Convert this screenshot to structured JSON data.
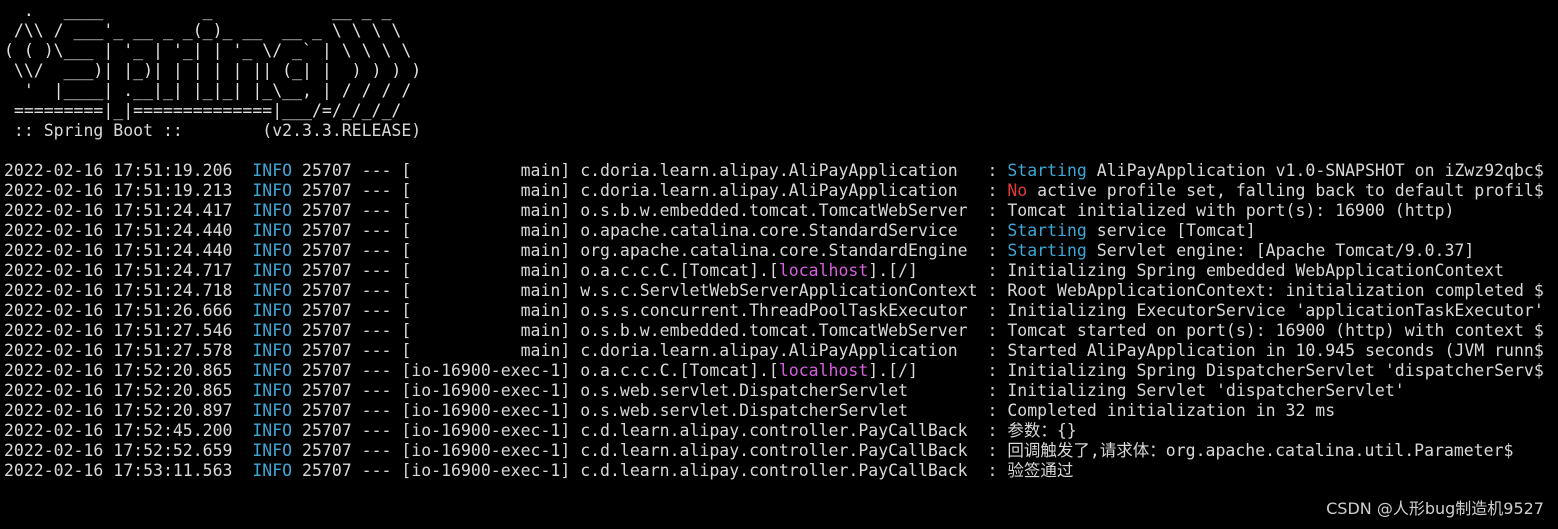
{
  "banner": {
    "ascii_lines": [
      "  .   ____          _            __ _ _",
      " /\\\\ / ___'_ __ _ _(_)_ __  __ _ \\ \\ \\ \\",
      "( ( )\\___ | '_ | '_| | '_ \\/ _` | \\ \\ \\ \\",
      " \\\\/  ___)| |_)| | | | | || (_| |  ) ) ) )",
      "  '  |____| .__|_| |_|_| |_\\__, | / / / /",
      " =========|_|==============|___/=/_/_/_/"
    ],
    "boot_line": " :: Spring Boot ::        (v2.3.3.RELEASE)"
  },
  "colors": {
    "background": "#000000",
    "text": "#d8d8d8",
    "info": "#3fa7d6",
    "starting": "#3fa7d6",
    "no": "#e03b3b",
    "localhost": "#d55fde"
  },
  "logs": [
    {
      "ts": "2022-02-16 17:51:19.206",
      "level": "INFO",
      "mid": " 25707 --- [           main] c.doria.learn.alipay.AliPayApplication   : ",
      "hl": "Starting",
      "hl_kind": "start",
      "rest": " AliPayApplication v1.0-SNAPSHOT on iZwz92qbc$"
    },
    {
      "ts": "2022-02-16 17:51:19.213",
      "level": "INFO",
      "mid": " 25707 --- [           main] c.doria.learn.alipay.AliPayApplication   : ",
      "hl": "No",
      "hl_kind": "no",
      "rest": " active profile set, falling back to default profil$"
    },
    {
      "ts": "2022-02-16 17:51:24.417",
      "level": "INFO",
      "mid": " 25707 --- [           main] o.s.b.w.embedded.tomcat.TomcatWebServer  : ",
      "hl": "",
      "hl_kind": "",
      "rest": "Tomcat initialized with port(s): 16900 (http)"
    },
    {
      "ts": "2022-02-16 17:51:24.440",
      "level": "INFO",
      "mid": " 25707 --- [           main] o.apache.catalina.core.StandardService   : ",
      "hl": "Starting",
      "hl_kind": "start",
      "rest": " service [Tomcat]"
    },
    {
      "ts": "2022-02-16 17:51:24.440",
      "level": "INFO",
      "mid": " 25707 --- [           main] org.apache.catalina.core.StandardEngine  : ",
      "hl": "Starting",
      "hl_kind": "start",
      "rest": " Servlet engine: [Apache Tomcat/9.0.37]"
    },
    {
      "ts": "2022-02-16 17:51:24.717",
      "level": "INFO",
      "mid": " 25707 --- [           main] o.a.c.c.C.[Tomcat].[",
      "hl": "localhost",
      "hl_kind": "local",
      "rest": "].[/]       : Initializing Spring embedded WebApplicationContext"
    },
    {
      "ts": "2022-02-16 17:51:24.718",
      "level": "INFO",
      "mid": " 25707 --- [           main] w.s.c.ServletWebServerApplicationContext : ",
      "hl": "",
      "hl_kind": "",
      "rest": "Root WebApplicationContext: initialization completed $"
    },
    {
      "ts": "2022-02-16 17:51:26.666",
      "level": "INFO",
      "mid": " 25707 --- [           main] o.s.s.concurrent.ThreadPoolTaskExecutor  : ",
      "hl": "",
      "hl_kind": "",
      "rest": "Initializing ExecutorService 'applicationTaskExecutor'"
    },
    {
      "ts": "2022-02-16 17:51:27.546",
      "level": "INFO",
      "mid": " 25707 --- [           main] o.s.b.w.embedded.tomcat.TomcatWebServer  : ",
      "hl": "",
      "hl_kind": "",
      "rest": "Tomcat started on port(s): 16900 (http) with context $"
    },
    {
      "ts": "2022-02-16 17:51:27.578",
      "level": "INFO",
      "mid": " 25707 --- [           main] c.doria.learn.alipay.AliPayApplication   : ",
      "hl": "",
      "hl_kind": "",
      "rest": "Started AliPayApplication in 10.945 seconds (JVM runn$"
    },
    {
      "ts": "2022-02-16 17:52:20.865",
      "level": "INFO",
      "mid": " 25707 --- [io-16900-exec-1] o.a.c.c.C.[Tomcat].[",
      "hl": "localhost",
      "hl_kind": "local",
      "rest": "].[/]       : Initializing Spring DispatcherServlet 'dispatcherServ$"
    },
    {
      "ts": "2022-02-16 17:52:20.865",
      "level": "INFO",
      "mid": " 25707 --- [io-16900-exec-1] o.s.web.servlet.DispatcherServlet        : ",
      "hl": "",
      "hl_kind": "",
      "rest": "Initializing Servlet 'dispatcherServlet'"
    },
    {
      "ts": "2022-02-16 17:52:20.897",
      "level": "INFO",
      "mid": " 25707 --- [io-16900-exec-1] o.s.web.servlet.DispatcherServlet        : ",
      "hl": "",
      "hl_kind": "",
      "rest": "Completed initialization in 32 ms"
    },
    {
      "ts": "2022-02-16 17:52:45.200",
      "level": "INFO",
      "mid": " 25707 --- [io-16900-exec-1] c.d.learn.alipay.controller.PayCallBack  : ",
      "hl": "",
      "hl_kind": "",
      "rest": "参数：{}"
    },
    {
      "ts": "2022-02-16 17:52:52.659",
      "level": "INFO",
      "mid": " 25707 --- [io-16900-exec-1] c.d.learn.alipay.controller.PayCallBack  : ",
      "hl": "",
      "hl_kind": "",
      "rest": "回调触发了,请求体：org.apache.catalina.util.Parameter$"
    },
    {
      "ts": "2022-02-16 17:53:11.563",
      "level": "INFO",
      "mid": " 25707 --- [io-16900-exec-1] c.d.learn.alipay.controller.PayCallBack  : ",
      "hl": "",
      "hl_kind": "",
      "rest": "验签通过"
    }
  ],
  "watermark": "CSDN @人形bug制造机9527"
}
